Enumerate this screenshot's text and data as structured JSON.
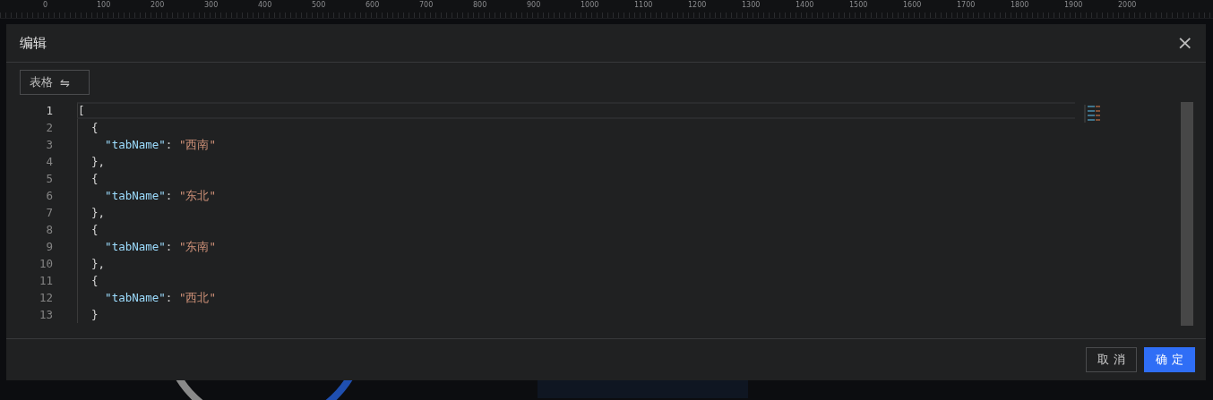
{
  "ruler": {
    "labels": [
      "0",
      "100",
      "200",
      "300",
      "400",
      "500",
      "600",
      "700",
      "800",
      "900",
      "1000",
      "1100",
      "1200",
      "1300",
      "1400",
      "1500",
      "1600",
      "1700",
      "1800",
      "1900",
      "2000"
    ]
  },
  "dialog": {
    "title": "编辑",
    "close": "×",
    "toolbar": {
      "toggle_label": "表格",
      "toggle_icon": "⇋"
    },
    "editor": {
      "lines": [
        {
          "number": "1",
          "current": true,
          "tokens": [
            {
              "kind": "punct",
              "text": "["
            }
          ]
        },
        {
          "number": "2",
          "current": false,
          "tokens": [
            {
              "kind": "punct",
              "text": "  {"
            }
          ]
        },
        {
          "number": "3",
          "current": false,
          "tokens": [
            {
              "kind": "key",
              "text": "    \"tabName\""
            },
            {
              "kind": "punct",
              "text": ": "
            },
            {
              "kind": "string",
              "text": "\"西南\""
            }
          ]
        },
        {
          "number": "4",
          "current": false,
          "tokens": [
            {
              "kind": "punct",
              "text": "  },"
            }
          ]
        },
        {
          "number": "5",
          "current": false,
          "tokens": [
            {
              "kind": "punct",
              "text": "  {"
            }
          ]
        },
        {
          "number": "6",
          "current": false,
          "tokens": [
            {
              "kind": "key",
              "text": "    \"tabName\""
            },
            {
              "kind": "punct",
              "text": ": "
            },
            {
              "kind": "string",
              "text": "\"东北\""
            }
          ]
        },
        {
          "number": "7",
          "current": false,
          "tokens": [
            {
              "kind": "punct",
              "text": "  },"
            }
          ]
        },
        {
          "number": "8",
          "current": false,
          "tokens": [
            {
              "kind": "punct",
              "text": "  {"
            }
          ]
        },
        {
          "number": "9",
          "current": false,
          "tokens": [
            {
              "kind": "key",
              "text": "    \"tabName\""
            },
            {
              "kind": "punct",
              "text": ": "
            },
            {
              "kind": "string",
              "text": "\"东南\""
            }
          ]
        },
        {
          "number": "10",
          "current": false,
          "tokens": [
            {
              "kind": "punct",
              "text": "  },"
            }
          ]
        },
        {
          "number": "11",
          "current": false,
          "tokens": [
            {
              "kind": "punct",
              "text": "  {"
            }
          ]
        },
        {
          "number": "12",
          "current": false,
          "tokens": [
            {
              "kind": "key",
              "text": "    \"tabName\""
            },
            {
              "kind": "punct",
              "text": ": "
            },
            {
              "kind": "string",
              "text": "\"西北\""
            }
          ]
        },
        {
          "number": "13",
          "current": false,
          "tokens": [
            {
              "kind": "punct",
              "text": "  }"
            }
          ]
        }
      ]
    },
    "buttons": [
      {
        "label": "取 消",
        "kind": "secondary"
      },
      {
        "label": "确 定",
        "kind": "primary"
      }
    ]
  }
}
